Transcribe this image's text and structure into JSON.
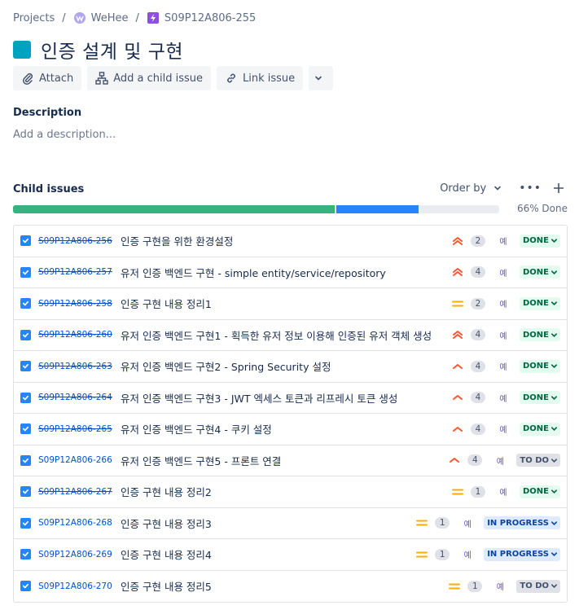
{
  "breadcrumb": {
    "projects": "Projects",
    "project": "WeHee",
    "issue_key": "S09P12A806-255"
  },
  "title": "인증 설계 및 구현",
  "toolbar": {
    "attach": "Attach",
    "add_child": "Add a child issue",
    "link_issue": "Link issue"
  },
  "description": {
    "label": "Description",
    "placeholder": "Add a description..."
  },
  "child_issues": {
    "label": "Child issues",
    "order_by": "Order by",
    "done_pct_text": "66% Done",
    "progress": {
      "done_fraction": 0.66,
      "in_progress_fraction": 0.17
    },
    "items": [
      {
        "key": "S09P12A806-256",
        "summary": "인증 구현을 위한 환경설정",
        "priority": "highest",
        "count": "2",
        "assignee": "예",
        "status": "DONE",
        "resolved": true
      },
      {
        "key": "S09P12A806-257",
        "summary": "유저 인증 백엔드 구현 - simple entity/service/repository",
        "priority": "highest",
        "count": "4",
        "assignee": "예",
        "status": "DONE",
        "resolved": true
      },
      {
        "key": "S09P12A806-258",
        "summary": "인증 구현 내용 정리1",
        "priority": "medium",
        "count": "2",
        "assignee": "예",
        "status": "DONE",
        "resolved": true
      },
      {
        "key": "S09P12A806-260",
        "summary": "유저 인증 백엔드 구현1 - 획득한 유저 정보 이용해 인증된 유저 객체 생성",
        "priority": "highest",
        "count": "4",
        "assignee": "예",
        "status": "DONE",
        "resolved": true
      },
      {
        "key": "S09P12A806-263",
        "summary": "유저 인증 백엔드 구현2 - Spring Security 설정",
        "priority": "high",
        "count": "4",
        "assignee": "예",
        "status": "DONE",
        "resolved": true
      },
      {
        "key": "S09P12A806-264",
        "summary": "유저 인증 백엔드 구현3 - JWT 엑세스 토큰과 리프레시 토큰 생성",
        "priority": "high",
        "count": "4",
        "assignee": "예",
        "status": "DONE",
        "resolved": true
      },
      {
        "key": "S09P12A806-265",
        "summary": "유저 인증 백엔드 구현4 - 쿠키 설정",
        "priority": "high",
        "count": "4",
        "assignee": "예",
        "status": "DONE",
        "resolved": true
      },
      {
        "key": "S09P12A806-266",
        "summary": "유저 인증 백엔드 구현5 - 프론트 연결",
        "priority": "high",
        "count": "4",
        "assignee": "예",
        "status": "TO DO",
        "resolved": false
      },
      {
        "key": "S09P12A806-267",
        "summary": "인증 구현 내용 정리2",
        "priority": "medium",
        "count": "1",
        "assignee": "예",
        "status": "DONE",
        "resolved": true
      },
      {
        "key": "S09P12A806-268",
        "summary": "인증 구현 내용 정리3",
        "priority": "medium",
        "count": "1",
        "assignee": "예",
        "status": "IN PROGRESS",
        "resolved": false
      },
      {
        "key": "S09P12A806-269",
        "summary": "인증 구현 내용 정리4",
        "priority": "medium",
        "count": "1",
        "assignee": "예",
        "status": "IN PROGRESS",
        "resolved": false
      },
      {
        "key": "S09P12A806-270",
        "summary": "인증 구현 내용 정리5",
        "priority": "medium",
        "count": "1",
        "assignee": "예",
        "status": "TO DO",
        "resolved": false
      }
    ]
  },
  "colors": {
    "title_swatch": "#00a3bf",
    "progress_done": "#36b37e",
    "progress_in_progress": "#2684ff",
    "priority_high": "#ff5630",
    "priority_medium": "#ffab00"
  }
}
